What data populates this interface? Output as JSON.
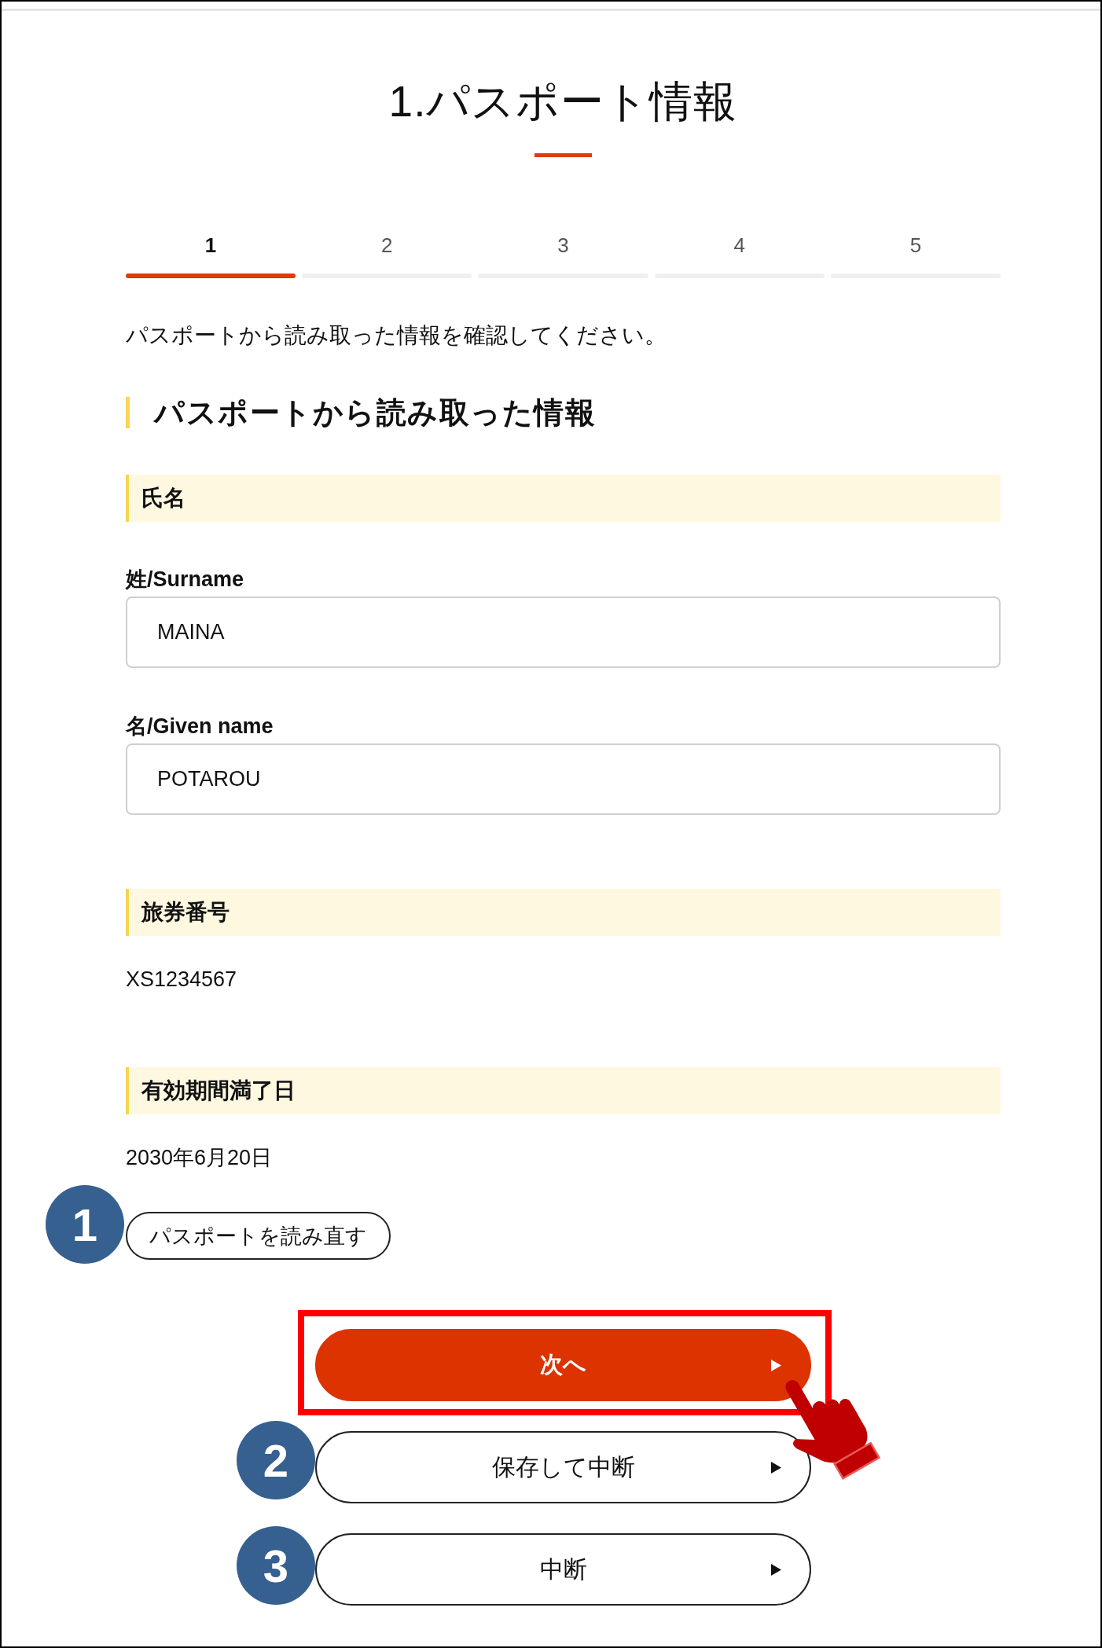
{
  "page": {
    "title": "1.パスポート情報"
  },
  "steps": [
    {
      "label": "1",
      "selected": true
    },
    {
      "label": "2",
      "selected": false
    },
    {
      "label": "3",
      "selected": false
    },
    {
      "label": "4",
      "selected": false
    },
    {
      "label": "5",
      "selected": false
    }
  ],
  "intro": "パスポートから読み取った情報を確認してください。",
  "section": {
    "heading": "パスポートから読み取った情報",
    "groups": [
      {
        "kind": "fields",
        "heading": "氏名",
        "fields": [
          {
            "label": "姓/Surname",
            "value": "MAINA"
          },
          {
            "label": "名/Given name",
            "value": "POTAROU"
          }
        ]
      },
      {
        "kind": "text",
        "heading": "旅券番号",
        "value": "XS1234567"
      },
      {
        "kind": "text",
        "heading": "有効期間満了日",
        "value": "2030年6月20日"
      }
    ]
  },
  "reread_button": {
    "label": "パスポートを読み直す",
    "callout": "1"
  },
  "actions": [
    {
      "kind": "primary",
      "label": "次へ",
      "highlighted": true
    },
    {
      "kind": "secondary",
      "label": "保存して中断",
      "highlighted": false,
      "callout": "2"
    },
    {
      "kind": "secondary",
      "label": "中断",
      "highlighted": false,
      "callout": "3"
    }
  ],
  "pointer_cursor": true
}
